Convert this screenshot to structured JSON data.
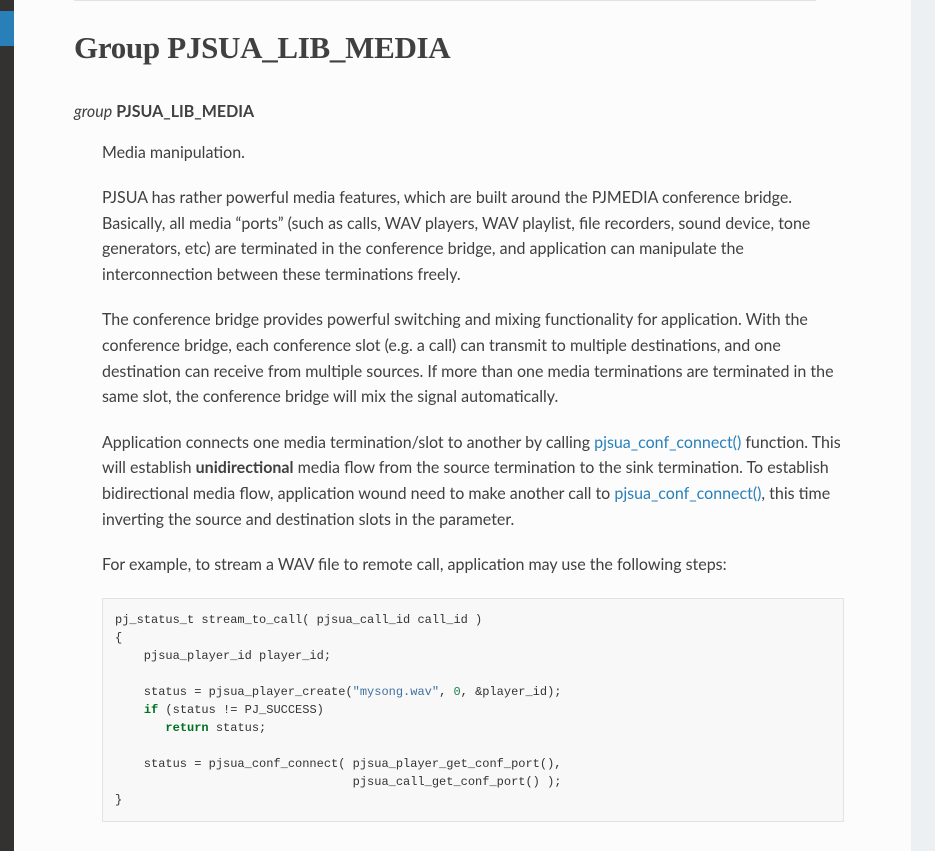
{
  "page": {
    "title": "Group PJSUA_LIB_MEDIA"
  },
  "group": {
    "kind": "group",
    "name": "PJSUA_LIB_MEDIA"
  },
  "desc": {
    "p1": "Media manipulation.",
    "p2": "PJSUA has rather powerful media features, which are built around the PJMEDIA conference bridge. Basically, all media “ports” (such as calls, WAV players, WAV playlist, file recorders, sound device, tone generators, etc) are terminated in the conference bridge, and application can manipulate the interconnection between these terminations freely.",
    "p3": "The conference bridge provides powerful switching and mixing functionality for application. With the conference bridge, each conference slot (e.g. a call) can transmit to multiple destinations, and one destination can receive from multiple sources. If more than one media terminations are terminated in the same slot, the conference bridge will mix the signal automatically.",
    "p4_pre": "Application connects one media termination/slot to another by calling ",
    "p4_link1": "pjsua_conf_connect()",
    "p4_mid1": " function. This will establish ",
    "p4_strong": "unidirectional",
    "p4_mid2": " media flow from the source termination to the sink termination. To establish bidirectional media flow, application wound need to make another call to ",
    "p4_link2": "pjsua_conf_connect()",
    "p4_post": ", this time inverting the source and destination slots in the parameter.",
    "p5": "For example, to stream a WAV file to remote call, application may use the following steps:"
  },
  "code": {
    "l1a": "pj_status_t stream_to_call( pjsua_call_id call_id )",
    "l2a": "{",
    "l3a": "    pjsua_player_id player_id;",
    "l5a": "    status = pjsua_player_create(",
    "l5s": "\"mysong.wav\"",
    "l5b": ", ",
    "l5n": "0",
    "l5c": ", &player_id);",
    "l6a": "    ",
    "l6kw": "if",
    "l6b": " (status != PJ_SUCCESS)",
    "l7a": "       ",
    "l7kw": "return",
    "l7b": " status;",
    "l9a": "    status = pjsua_conf_connect( pjsua_player_get_conf_port(),",
    "l10a": "                                 pjsua_call_get_conf_port() );",
    "l11a": "}"
  }
}
